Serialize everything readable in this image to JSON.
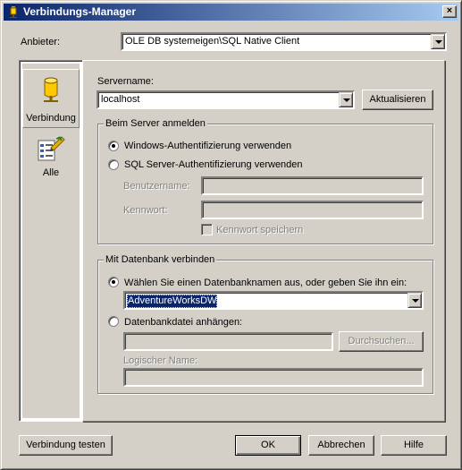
{
  "window": {
    "title": "Verbindungs-Manager",
    "close_glyph": "×"
  },
  "provider": {
    "label": "Anbieter:",
    "value": "OLE DB systemeigen\\SQL Native Client"
  },
  "sidebar": {
    "items": [
      {
        "label": "Verbindung",
        "icon": "database-cylinder-icon",
        "active": true
      },
      {
        "label": "Alle",
        "icon": "properties-list-icon",
        "active": false
      }
    ]
  },
  "server": {
    "label": "Servername:",
    "value": "localhost",
    "refresh_label": "Aktualisieren"
  },
  "logon": {
    "title": "Beim Server anmelden",
    "windows_auth_label": "Windows-Authentifizierung verwenden",
    "sql_auth_label": "SQL Server-Authentifizierung verwenden",
    "selected": "windows",
    "username_label": "Benutzername:",
    "password_label": "Kennwort:",
    "save_password_label": "Kennwort speichern"
  },
  "database": {
    "title": "Mit Datenbank verbinden",
    "select_label": "Wählen Sie einen Datenbanknamen aus, oder geben Sie ihn ein:",
    "selected_db": "AdventureWorksDW",
    "attach_label": "Datenbankdatei anhängen:",
    "browse_label": "Durchsuchen...",
    "logical_name_label": "Logischer Name:",
    "selected": "select"
  },
  "footer": {
    "test_label": "Verbindung testen",
    "ok_label": "OK",
    "cancel_label": "Abbrechen",
    "help_label": "Hilfe"
  },
  "colors": {
    "titlebar_start": "#0a246a",
    "titlebar_end": "#a6caf0",
    "face": "#d4d0c8",
    "selection": "#0a246a"
  }
}
